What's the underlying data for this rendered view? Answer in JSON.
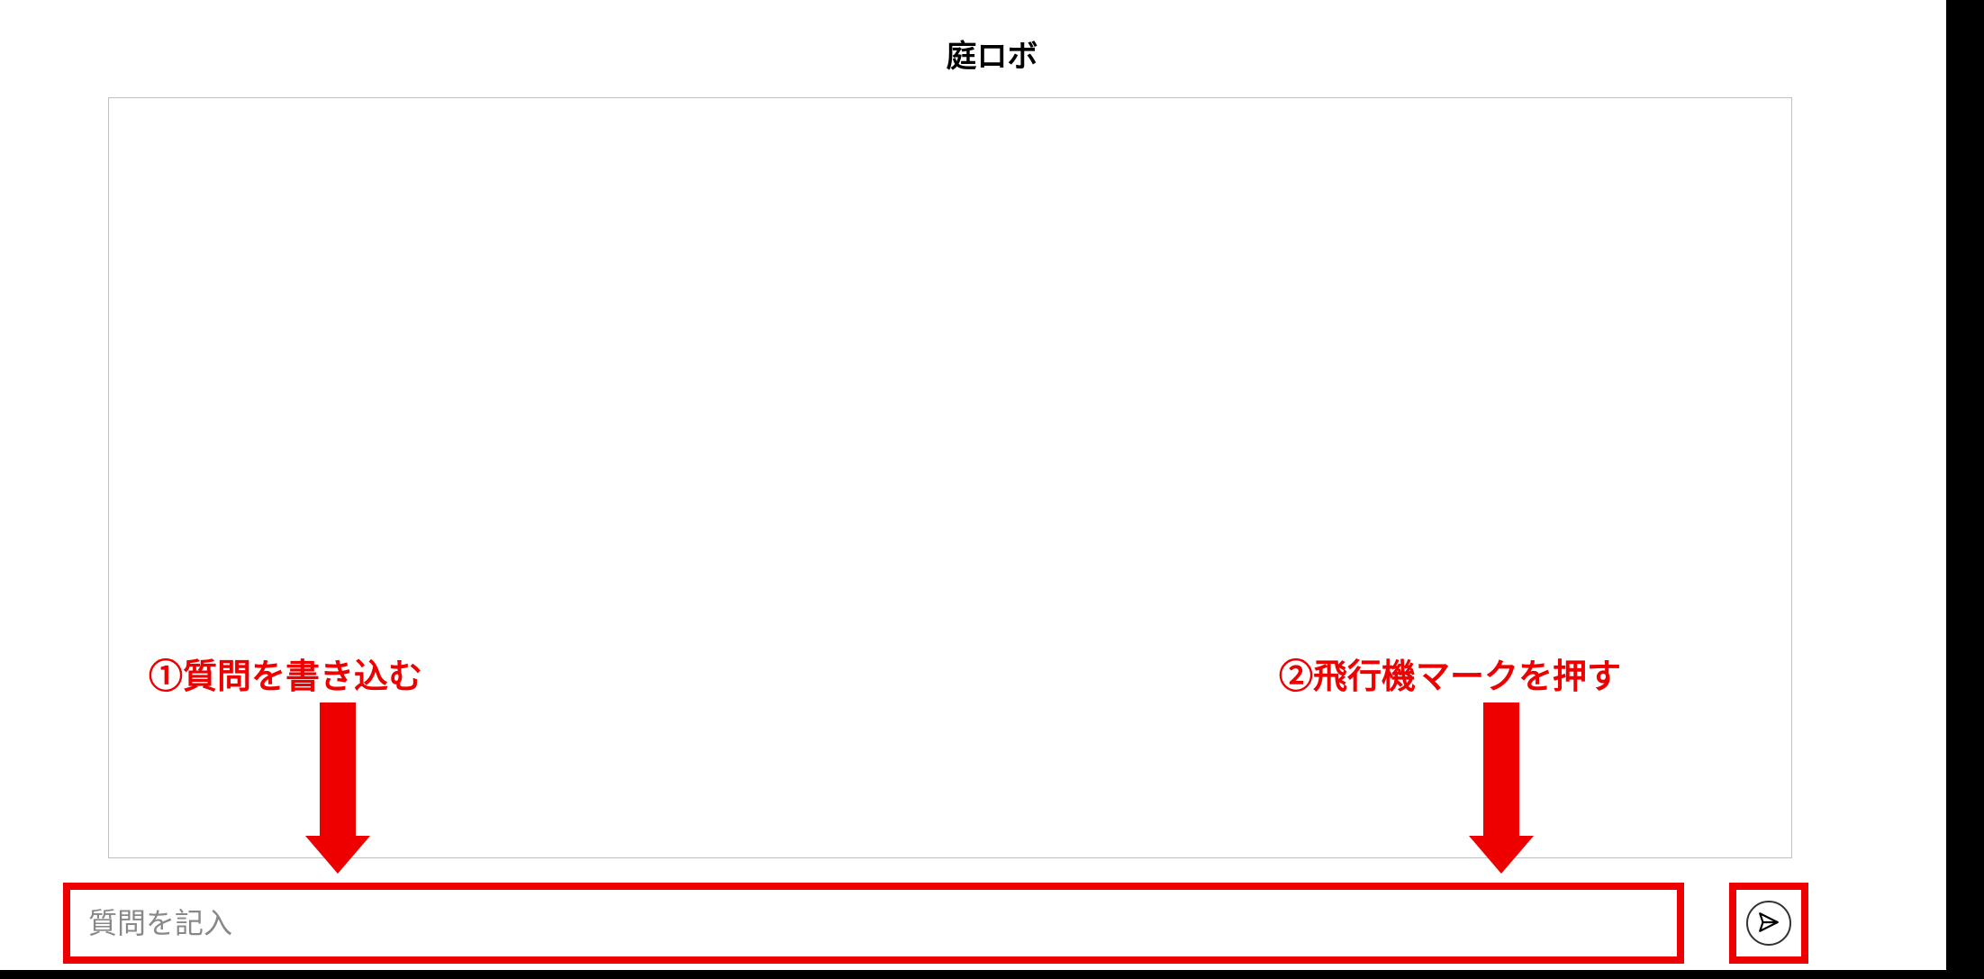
{
  "header": {
    "title": "庭ロボ"
  },
  "input": {
    "placeholder": "質問を記入",
    "value": ""
  },
  "annotations": {
    "step1": "①質問を書き込む",
    "step2": "②飛行機マークを押す"
  },
  "colors": {
    "highlight": "#ee0000"
  },
  "icons": {
    "send": "paper-plane-icon"
  }
}
